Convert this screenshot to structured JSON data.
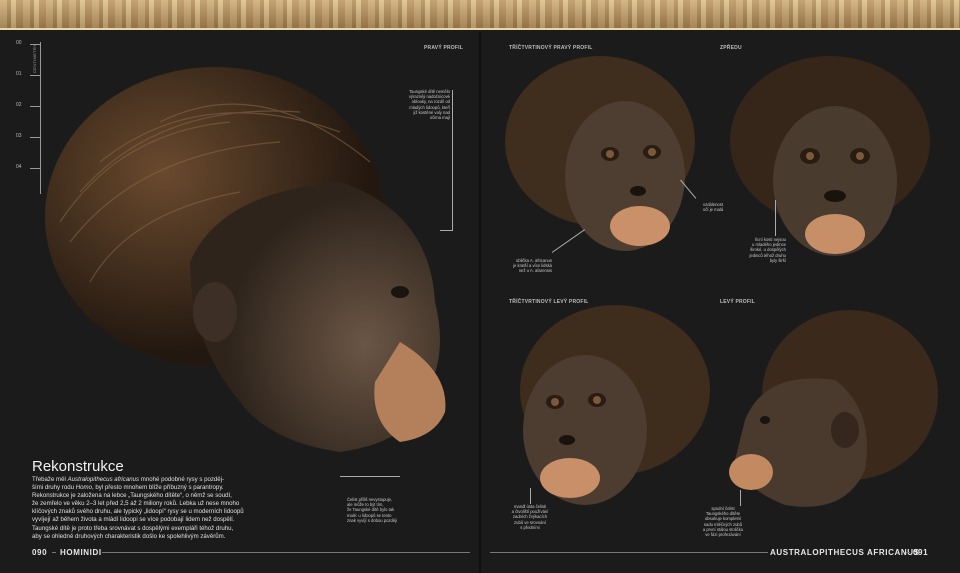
{
  "ruler": {
    "ticks": [
      "00",
      "01",
      "02",
      "03",
      "04"
    ],
    "unit": "CENTIMETRY"
  },
  "views": {
    "right_profile": "PRAVÝ PROFIL",
    "three_quarter_right": "TŘÍČTVRTINOVÝ PRAVÝ PROFIL",
    "front": "ZPŘEDU",
    "three_quarter_left": "TŘÍČTVRTINOVÝ LEVÝ PROFIL",
    "left_profile": "LEVÝ PROFIL"
  },
  "notes": {
    "brow": [
      "Taungské dítě nemělo",
      "výrazněji nadočnicové",
      "oblouky, na rozdíl od",
      "mladých lidoopů, kteří",
      "již kostěné valy nad",
      "očima mají"
    ],
    "jaw": [
      "Čelist příliš nevystupuje,",
      "ale může to být tím,",
      "že Taungské dítě bylo tak",
      "malé: u lidoopů se tento",
      "znak vyvíjí s dobou později"
    ],
    "skull": [
      "oblička A. africanus",
      "je kratší a více lidská",
      "než u A. afarensis"
    ],
    "eyes": [
      "vzdálenost",
      "očí je malá"
    ],
    "cheekbones": [
      "lícní kosti nejsou",
      "u mladého jedince",
      "široké, u dospělých",
      "jedinců téhož druhu",
      "byly širší"
    ],
    "teeth": [
      "mandl ústa čelisti",
      "a čtvoliští používání",
      "zadních žvýkacích",
      "zubů ve srovnání",
      "s předními"
    ],
    "lower_jaw": [
      "spodní čelist",
      "Taungského dítěte",
      "obsahuje kompletní",
      "sadu mléčných zubů",
      "a první stálou stoličku",
      "ve fázi prořezávání"
    ]
  },
  "article": {
    "heading": "Rekonstrukce",
    "body_lines": [
      [
        "Třebaže měl ",
        "Australopithecus africanus",
        " mnohé podobné rysy s pozděj-"
      ],
      [
        "šími druhy rodu ",
        "Homo",
        ", byl přesto mnohem blíže příbuzný s parantropy."
      ],
      [
        "Rekonstrukce je založena na lebce „Taungského dítěte“, o němž se soudí,"
      ],
      [
        "že zemřelo ve věku 2–3 let před 2,5 až 2 miliony roků. Lebka už nese mnoho"
      ],
      [
        "klíčových znaků svého druhu, ale typický „lidoopí“ rysy se u moderních lidoopů"
      ],
      [
        "vyvíjejí až během života a mládí lidoopi se více podobají lidem než dospělí."
      ],
      [
        "Taungské dítě je proto třeba srovnávat s dospělými exempláři téhož druhu,"
      ],
      [
        "aby se ohledně druhových charakteristik došlo ke spolehlivým závěrům."
      ]
    ]
  },
  "footer": {
    "left_page": "090",
    "left_title": "HOMINIDI",
    "right_title": "AUSTRALOPITHECUS AFRICANUS",
    "right_page": "091"
  },
  "colors": {
    "background": "#1b1b1b",
    "skin": "#5e4b3c",
    "hair": "#3a2a1d",
    "muzzle": "#c7926a",
    "banner": "#c7a46d"
  }
}
